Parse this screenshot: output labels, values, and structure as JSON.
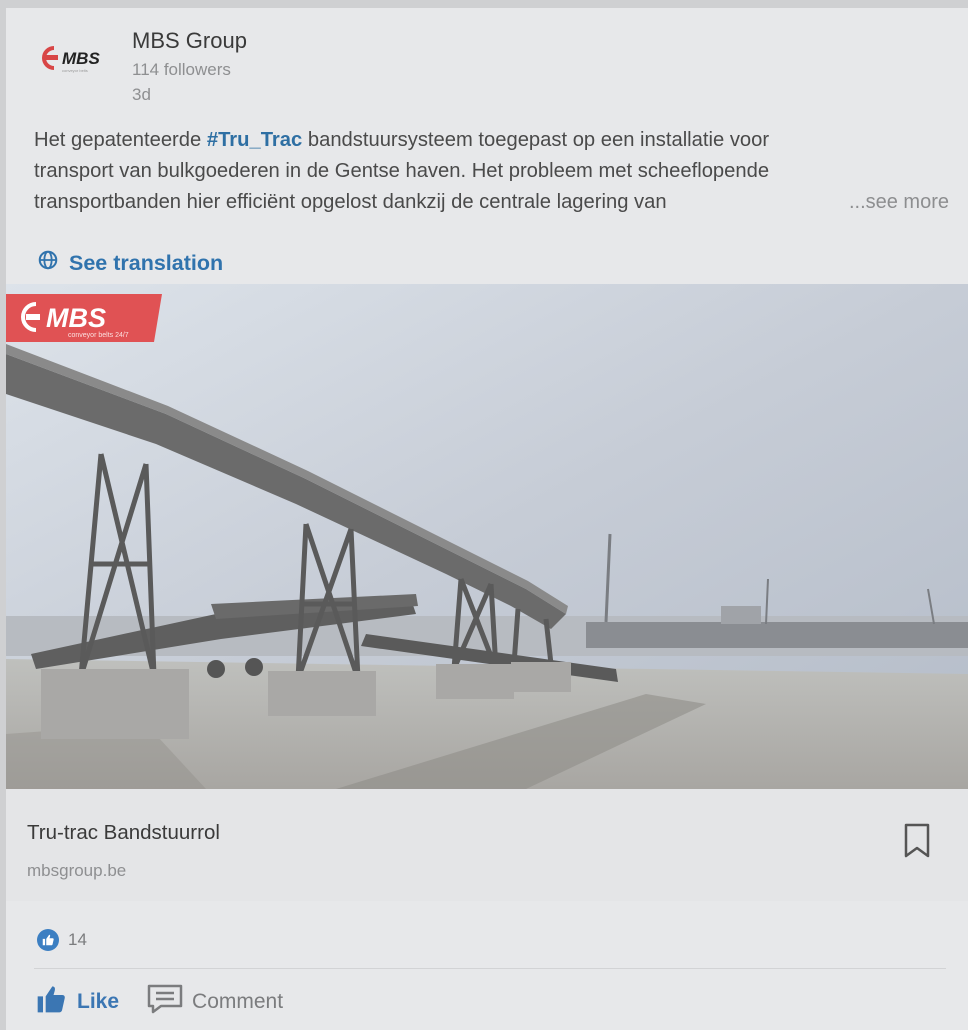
{
  "post": {
    "company": "MBS Group",
    "followers": "114 followers",
    "time": "3d",
    "text_line1_pre": "Het gepatenteerde ",
    "hashtag": "#Tru_Trac",
    "text_line1_post": " bandstuursysteem toegepast op een installatie voor",
    "text_line2": "transport van bulkgoederen in de Gentse haven. Het probleem met scheeflopende",
    "text_line3": "transportbanden hier efficiënt opgelost dankzij de centrale lagering van",
    "see_more": "...see more",
    "see_translation": "See translation"
  },
  "logo": {
    "text": "MBS",
    "tagline": "conveyor belts 24/7"
  },
  "link_preview": {
    "title": "Tru-trac Bandstuurrol",
    "url": "mbsgroup.be"
  },
  "social": {
    "reaction_count": "14",
    "like_label": "Like",
    "comment_label": "Comment"
  },
  "colors": {
    "accent": "#3073ad",
    "brand_red": "#e0474a"
  },
  "icons": {
    "globe": "globe-icon",
    "bookmark": "bookmark-icon",
    "like": "thumbs-up-icon",
    "comment": "comment-icon"
  }
}
